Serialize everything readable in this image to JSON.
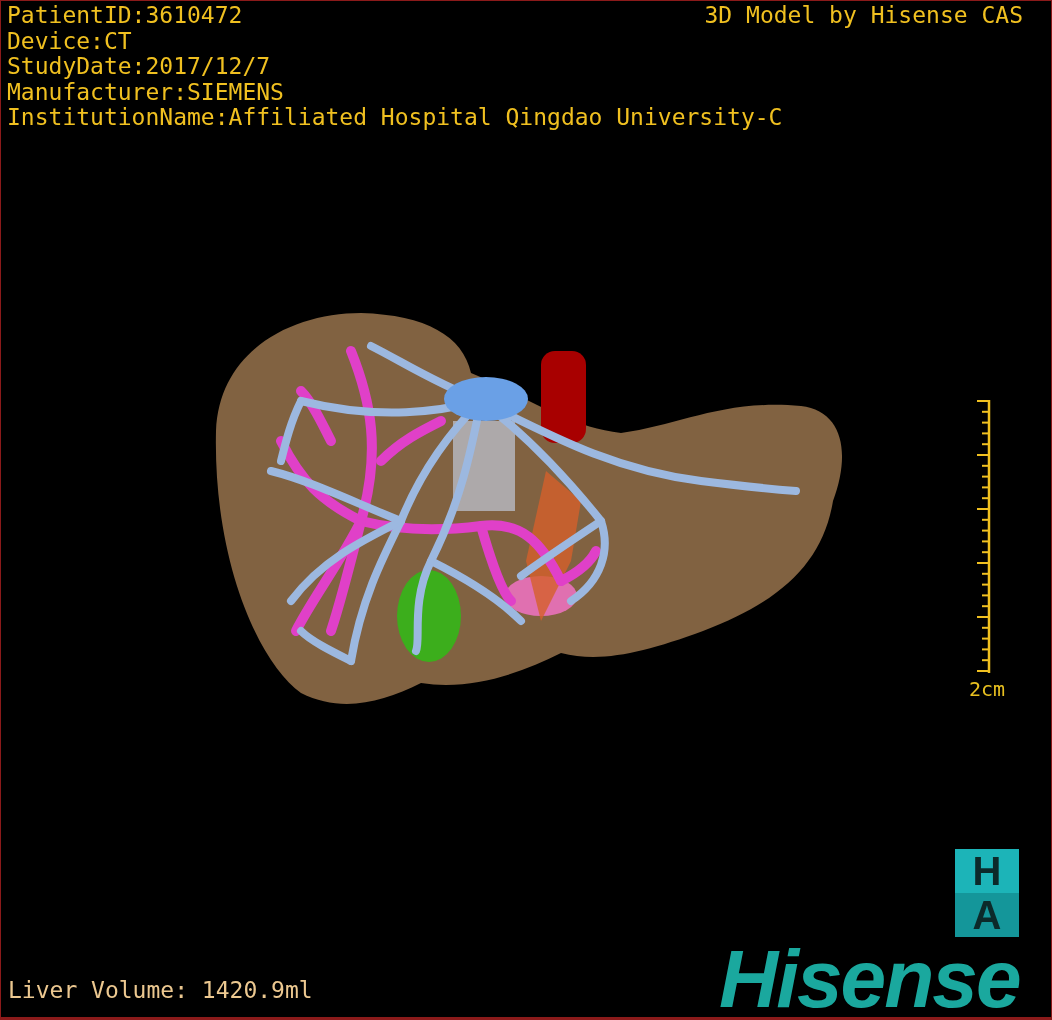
{
  "study_info": [
    "PatientID:3610472",
    "Device:CT",
    "StudyDate:2017/12/7",
    "Manufacturer:SIEMENS",
    "InstitutionName:Affiliated Hospital Qingdao University-C"
  ],
  "model_credit": "3D Model by Hisense CAS",
  "scale_bar": {
    "label": "2cm"
  },
  "logo": {
    "badge_letters": [
      "H",
      "A"
    ],
    "wordmark": "Hisense"
  },
  "liver_volume": "Liver Volume: 1420.9ml"
}
